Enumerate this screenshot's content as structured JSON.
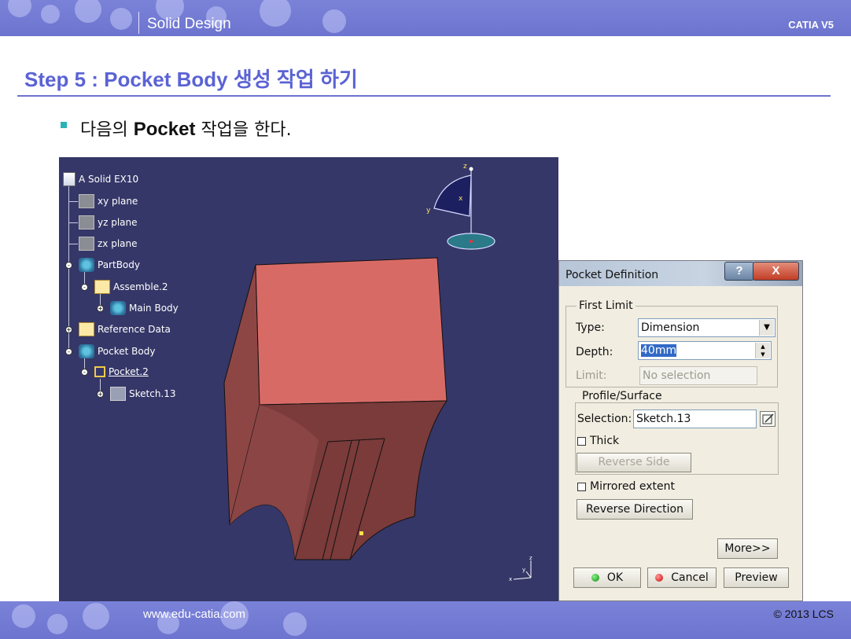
{
  "header": {
    "title": "Solid Design",
    "brand": "CATIA V5"
  },
  "slide": {
    "step_title": "Step 5 : Pocket Body 생성 작업 하기",
    "bullet_prefix": "다음의",
    "bullet_bold": "Pocket",
    "bullet_suffix": "작업을 한다."
  },
  "tree": {
    "root": "A Solid EX10",
    "items": [
      "xy plane",
      "yz plane",
      "zx plane",
      "PartBody",
      "Assemble.2",
      "Main Body",
      "Reference Data",
      "Pocket Body",
      "Pocket.2",
      "Sketch.13"
    ]
  },
  "compass": {
    "x_label": "x",
    "y_label": "y",
    "z_label": "z"
  },
  "axes_mini": {
    "x_label": "x",
    "y_label": "y",
    "z_label": "z"
  },
  "dialog": {
    "title": "Pocket Definition",
    "help_icon": "?",
    "close_icon": "X",
    "first_limit": {
      "label": "First Limit",
      "type_label": "Type:",
      "type_value": "Dimension",
      "depth_label": "Depth:",
      "depth_value": "40mm",
      "limit_label": "Limit:",
      "limit_placeholder": "No selection"
    },
    "profile": {
      "label": "Profile/Surface",
      "selection_label": "Selection:",
      "selection_value": "Sketch.13",
      "thick_label": "Thick",
      "reverse_side_label": "Reverse Side"
    },
    "mirrored_label": "Mirrored extent",
    "reverse_direction_label": "Reverse Direction",
    "more_label": "More>>",
    "ok_label": "OK",
    "cancel_label": "Cancel",
    "preview_label": "Preview"
  },
  "colors": {
    "viewport_bg": "#353768",
    "solid_top": "#d86a66",
    "solid_side": "#7a3b3a",
    "accent": "#5b63d4"
  },
  "footer": {
    "url": "www.edu-catia.com",
    "copyright": "© 2013 LCS"
  }
}
